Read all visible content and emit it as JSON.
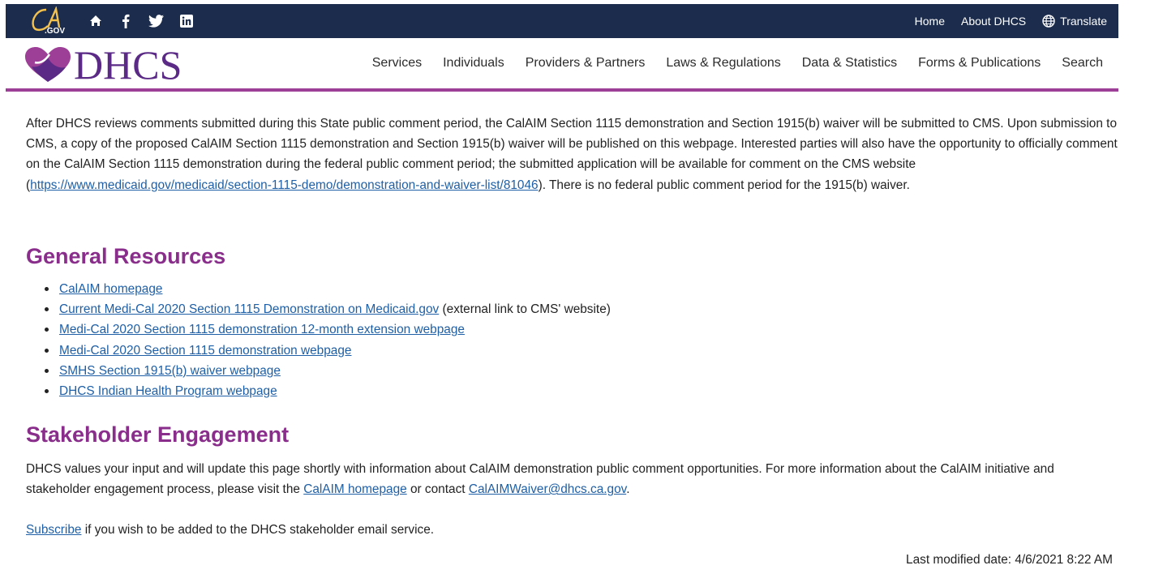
{
  "topbar": {
    "ca_logo_text": "CA.GOV",
    "util_links": [
      "Home",
      "About DHCS",
      "Translate"
    ]
  },
  "brand": {
    "text": "DHCS"
  },
  "nav": [
    "Services",
    "Individuals",
    "Providers & Partners",
    "Laws & Regulations",
    "Data & Statistics",
    "Forms & Publications",
    "Search"
  ],
  "intro": {
    "text_before": "After DHCS reviews comments submitted during this State public comment period, the CalAIM Section 1115 demonstration and Section 1915(b) waiver will be submitted to CMS. Upon submission to CMS, a copy of the proposed CalAIM Section 1115 demonstration and Section 1915(b) waiver will be published on this webpage. Interested parties will also have the opportunity to officially comment on the CalAIM Section 1115 demonstration during the federal public comment period; the submitted application will be available for comment on the CMS website (",
    "link": "https://www.medicaid.gov/medicaid/section-1115-demo/demonstration-and-waiver-list/81046",
    "text_after": "). There is no federal public comment period for the 1915(b) waiver."
  },
  "general": {
    "heading": "General Resources",
    "items": [
      {
        "link": "CalAIM homepage",
        "suffix": ""
      },
      {
        "link": "Current Medi-Cal 2020 Section 1115 Demonstration on Medicaid.gov",
        "suffix": " (external link to CMS' website)"
      },
      {
        "link": "Medi-Cal 2020 Section 1115 demonstration 12-month extension webpage",
        "suffix": ""
      },
      {
        "link": "Medi-Cal 2020 Section 1115 demonstration webpage",
        "suffix": ""
      },
      {
        "link": "SMHS Section 1915(b) waiver webpage",
        "suffix": ""
      },
      {
        "link": "DHCS Indian Health Program webpage",
        "suffix": ""
      }
    ]
  },
  "stakeholder": {
    "heading": "Stakeholder Engagement",
    "text1": "DHCS values your input and will update this page shortly with information about CalAIM demonstration public comment opportunities. For more information about the CalAIM initiative and stakeholder engagement process, please visit the ",
    "link1": "CalAIM homepage",
    "text2": " or contact ",
    "link2": "CalAIMWaiver@dhcs.ca.gov",
    "text3": "."
  },
  "subscribe": {
    "link": "Subscribe",
    "text": " if you wish to be added to the DHCS stakeholder email service."
  },
  "footer": {
    "modified": "Last modified date: 4/6/2021 8:22 AM"
  },
  "colors": {
    "topbar": "#1c2c4c",
    "accent": "#9d3e97",
    "heading": "#8a2e8c",
    "link": "#1f5fa5",
    "brand": "#5a2a86"
  }
}
